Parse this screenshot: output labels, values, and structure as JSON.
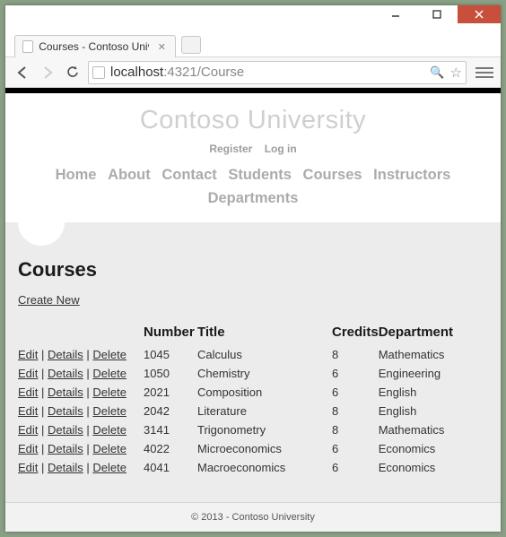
{
  "window": {
    "tab_title": "Courses - Contoso Univers"
  },
  "address": {
    "host": "localhost",
    "port_path": ":4321/Course"
  },
  "brand": "Contoso University",
  "auth": {
    "register": "Register",
    "login": "Log in"
  },
  "nav": {
    "home": "Home",
    "about": "About",
    "contact": "Contact",
    "students": "Students",
    "courses": "Courses",
    "instructors": "Instructors",
    "departments": "Departments"
  },
  "page": {
    "heading": "Courses",
    "create": "Create New"
  },
  "table": {
    "headers": {
      "number": "Number",
      "title": "Title",
      "credits": "Credits",
      "department": "Department"
    },
    "actions": {
      "edit": "Edit",
      "details": "Details",
      "delete": "Delete"
    },
    "rows": [
      {
        "number": "1045",
        "title": "Calculus",
        "credits": "8",
        "department": "Mathematics"
      },
      {
        "number": "1050",
        "title": "Chemistry",
        "credits": "6",
        "department": "Engineering"
      },
      {
        "number": "2021",
        "title": "Composition",
        "credits": "6",
        "department": "English"
      },
      {
        "number": "2042",
        "title": "Literature",
        "credits": "8",
        "department": "English"
      },
      {
        "number": "3141",
        "title": "Trigonometry",
        "credits": "8",
        "department": "Mathematics"
      },
      {
        "number": "4022",
        "title": "Microeconomics",
        "credits": "6",
        "department": "Economics"
      },
      {
        "number": "4041",
        "title": "Macroeconomics",
        "credits": "6",
        "department": "Economics"
      }
    ]
  },
  "footer": "© 2013 - Contoso University"
}
